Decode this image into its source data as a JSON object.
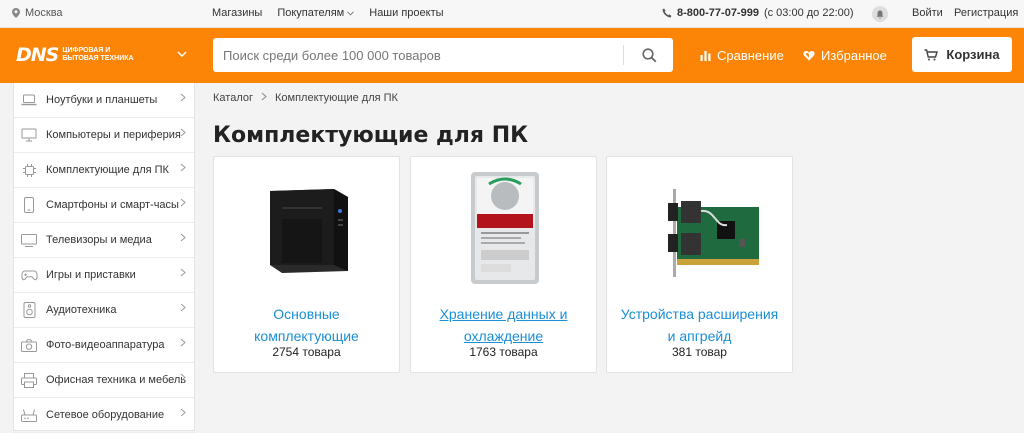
{
  "topbar": {
    "city": "Москва",
    "links": [
      "Магазины",
      "Покупателям",
      "Наши проекты"
    ],
    "phone": "8-800-77-07-999",
    "hours": "(с 03:00 до 22:00)",
    "login": "Войти",
    "register": "Регистрация"
  },
  "header": {
    "logo": "DNS",
    "logo_tagline": "цифровая и бытовая техника",
    "search_placeholder": "Поиск среди более 100 000 товаров",
    "compare": "Сравнение",
    "favorites": "Избранное",
    "cart": "Корзина",
    "accent": "#fc8507"
  },
  "sidebar": {
    "items": [
      {
        "label": "Ноутбуки и планшеты",
        "icon": "laptop-icon"
      },
      {
        "label": "Компьютеры и периферия",
        "icon": "monitor-icon"
      },
      {
        "label": "Комплектующие для ПК",
        "icon": "cpu-icon"
      },
      {
        "label": "Смартфоны и смарт-часы",
        "icon": "smartphone-icon"
      },
      {
        "label": "Телевизоры и медиа",
        "icon": "tv-icon"
      },
      {
        "label": "Игры и приставки",
        "icon": "gamepad-icon"
      },
      {
        "label": "Аудиотехника",
        "icon": "speaker-icon"
      },
      {
        "label": "Фото-видеоаппаратура",
        "icon": "camera-icon"
      },
      {
        "label": "Офисная техника и мебель",
        "icon": "printer-icon"
      },
      {
        "label": "Сетевое оборудование",
        "icon": "router-icon"
      }
    ]
  },
  "breadcrumb": [
    "Каталог",
    "Комплектующие для ПК"
  ],
  "page_title": "Комплектующие для ПК",
  "cards": [
    {
      "name_line1": "Основные",
      "name_line2": "комплектующие",
      "count": "2754 товара",
      "image": "pc-case-image"
    },
    {
      "name_line1": "Хранение данных и",
      "name_line2": "охлаждение",
      "count": "1763 товара",
      "image": "hard-drive-image"
    },
    {
      "name_line1": "Устройства расширения",
      "name_line2": "и апгрейд",
      "count": "381 товар",
      "image": "expansion-card-image"
    }
  ]
}
